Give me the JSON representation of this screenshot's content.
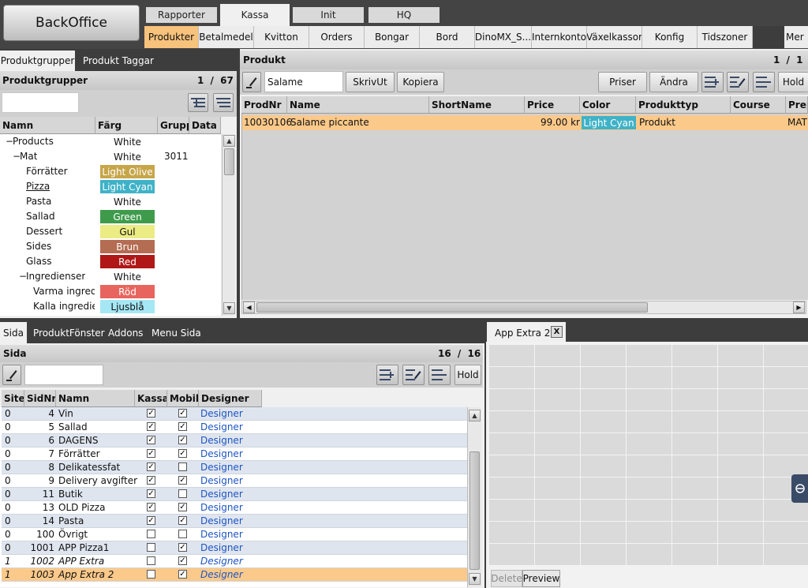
{
  "app": {
    "backoffice_label": "BackOffice"
  },
  "top_tabs": [
    {
      "label": "Rapporter"
    },
    {
      "label": "Kassa"
    },
    {
      "label": "Init"
    },
    {
      "label": "HQ"
    }
  ],
  "sub_tabs": [
    {
      "label": "Produkter"
    },
    {
      "label": "Betalmedel"
    },
    {
      "label": "Kvitton"
    },
    {
      "label": "Orders"
    },
    {
      "label": "Bongar"
    },
    {
      "label": "Bord"
    },
    {
      "label": "DinoMX_S..."
    },
    {
      "label": "Internkonto"
    },
    {
      "label": "Växelkassor"
    },
    {
      "label": "Konfig"
    },
    {
      "label": "Tidszoner"
    },
    {
      "label": "Mer"
    }
  ],
  "left_panel": {
    "tabs": [
      {
        "label": "Produktgrupper"
      },
      {
        "label": "Produkt Taggar"
      }
    ],
    "title": "Produktgrupper",
    "page_current": "1",
    "page_sep": "/",
    "page_total": "67",
    "search_value": "",
    "columns": [
      "Namn",
      "Färg",
      "Grupp",
      "Data"
    ],
    "rows": [
      {
        "expander": "−",
        "name": "Products",
        "color_name": "White",
        "group": "",
        "bg": "#ffffff",
        "fg": "#111111",
        "underline": false
      },
      {
        "expander": "−",
        "name": "Mat",
        "color_name": "White",
        "group": "3011",
        "bg": "#ffffff",
        "fg": "#111111",
        "underline": false
      },
      {
        "expander": "",
        "name": "Förrätter",
        "color_name": "Light Olive",
        "group": "",
        "bg": "#c7a64a",
        "fg": "#ffffff",
        "underline": false
      },
      {
        "expander": "",
        "name": "Pizza",
        "color_name": "Light Cyan",
        "group": "",
        "bg": "#3fb2c7",
        "fg": "#ffffff",
        "underline": true
      },
      {
        "expander": "",
        "name": "Pasta",
        "color_name": "White",
        "group": "",
        "bg": "#ffffff",
        "fg": "#111111",
        "underline": false
      },
      {
        "expander": "",
        "name": "Sallad",
        "color_name": "Green",
        "group": "",
        "bg": "#3f9b4c",
        "fg": "#ffffff",
        "underline": false
      },
      {
        "expander": "",
        "name": "Dessert",
        "color_name": "Gul",
        "group": "",
        "bg": "#ecec84",
        "fg": "#111111",
        "underline": false
      },
      {
        "expander": "",
        "name": "Sides",
        "color_name": "Brun",
        "group": "",
        "bg": "#b46c52",
        "fg": "#ffffff",
        "underline": false
      },
      {
        "expander": "",
        "name": "Glass",
        "color_name": "Red",
        "group": "",
        "bg": "#b01818",
        "fg": "#ffffff",
        "underline": false
      },
      {
        "expander": "−",
        "name": "Ingredienser",
        "color_name": "White",
        "group": "",
        "bg": "#ffffff",
        "fg": "#111111",
        "underline": false
      },
      {
        "expander": "",
        "name": "Varma ingredi",
        "color_name": "Röd",
        "group": "",
        "bg": "#e8655f",
        "fg": "#ffffff",
        "underline": false
      },
      {
        "expander": "",
        "name": "Kalla ingredie",
        "color_name": "Ljusblå",
        "group": "",
        "bg": "#a5e7f4",
        "fg": "#111111",
        "underline": false
      }
    ]
  },
  "product_panel": {
    "title": "Produkt",
    "page_current": "1",
    "page_sep": "/",
    "page_total": "1",
    "search_value": "Salame",
    "buttons": {
      "print": "SkrivUt",
      "copy": "Kopiera",
      "prices": "Priser",
      "edit": "Ändra",
      "hold": "Hold"
    },
    "columns": [
      "ProdNr",
      "Name",
      "ShortName",
      "Price",
      "Color",
      "Produkttyp",
      "Course",
      "Prep"
    ],
    "rows": [
      {
        "prodnr": "10030106",
        "name": "Salame piccante",
        "shortname": "",
        "price": "99.00 kr",
        "color": "Light Cyan",
        "type": "Produkt",
        "course": "",
        "prep": "MAT"
      }
    ]
  },
  "sida_panel": {
    "tabs": [
      {
        "label": "Sida"
      },
      {
        "label": "ProduktFönster"
      },
      {
        "label": "Addons"
      },
      {
        "label": "Menu Sida"
      }
    ],
    "title": "Sida",
    "page_current": "16",
    "page_sep": "/",
    "page_total": "16",
    "search_value": "",
    "hold_label": "Hold",
    "columns": [
      "Site",
      "SidNr",
      "Namn",
      "Kassa",
      "Mobil",
      "Designer"
    ],
    "rows": [
      {
        "site": "0",
        "sidnr": "4",
        "name": "Vin",
        "kassa": true,
        "mobil": true,
        "designer": "Designer",
        "italic": false,
        "selected": false
      },
      {
        "site": "0",
        "sidnr": "5",
        "name": "Sallad",
        "kassa": true,
        "mobil": true,
        "designer": "Designer",
        "italic": false,
        "selected": false
      },
      {
        "site": "0",
        "sidnr": "6",
        "name": "DAGENS",
        "kassa": true,
        "mobil": true,
        "designer": "Designer",
        "italic": false,
        "selected": false
      },
      {
        "site": "0",
        "sidnr": "7",
        "name": "Förrätter",
        "kassa": true,
        "mobil": true,
        "designer": "Designer",
        "italic": false,
        "selected": false
      },
      {
        "site": "0",
        "sidnr": "8",
        "name": "Delikatessfat",
        "kassa": true,
        "mobil": false,
        "designer": "Designer",
        "italic": false,
        "selected": false
      },
      {
        "site": "0",
        "sidnr": "9",
        "name": "Delivery avgifter",
        "kassa": true,
        "mobil": true,
        "designer": "Designer",
        "italic": false,
        "selected": false
      },
      {
        "site": "0",
        "sidnr": "11",
        "name": "Butik",
        "kassa": true,
        "mobil": false,
        "designer": "Designer",
        "italic": false,
        "selected": false
      },
      {
        "site": "0",
        "sidnr": "13",
        "name": "OLD Pizza",
        "kassa": true,
        "mobil": true,
        "designer": "Designer",
        "italic": false,
        "selected": false
      },
      {
        "site": "0",
        "sidnr": "14",
        "name": "Pasta",
        "kassa": true,
        "mobil": true,
        "designer": "Designer",
        "italic": false,
        "selected": false
      },
      {
        "site": "0",
        "sidnr": "100",
        "name": "Övrigt",
        "kassa": false,
        "mobil": false,
        "designer": "Designer",
        "italic": false,
        "selected": false
      },
      {
        "site": "0",
        "sidnr": "1001",
        "name": "APP Pizza1",
        "kassa": false,
        "mobil": true,
        "designer": "Designer",
        "italic": false,
        "selected": false
      },
      {
        "site": "1",
        "sidnr": "1002",
        "name": "APP Extra",
        "kassa": false,
        "mobil": true,
        "designer": "Designer",
        "italic": true,
        "selected": false
      },
      {
        "site": "1",
        "sidnr": "1003",
        "name": "App Extra 2",
        "kassa": false,
        "mobil": true,
        "designer": "Designer",
        "italic": true,
        "selected": true
      }
    ]
  },
  "designer_panel": {
    "tab_label": "App Extra 2",
    "close_label": "X",
    "delete_label": "Delete",
    "preview_label": "Preview"
  },
  "colors": {
    "accent_orange": "#f7c27c",
    "selected_row": "#fbc98a",
    "dark_bar": "#3d3d3d"
  }
}
